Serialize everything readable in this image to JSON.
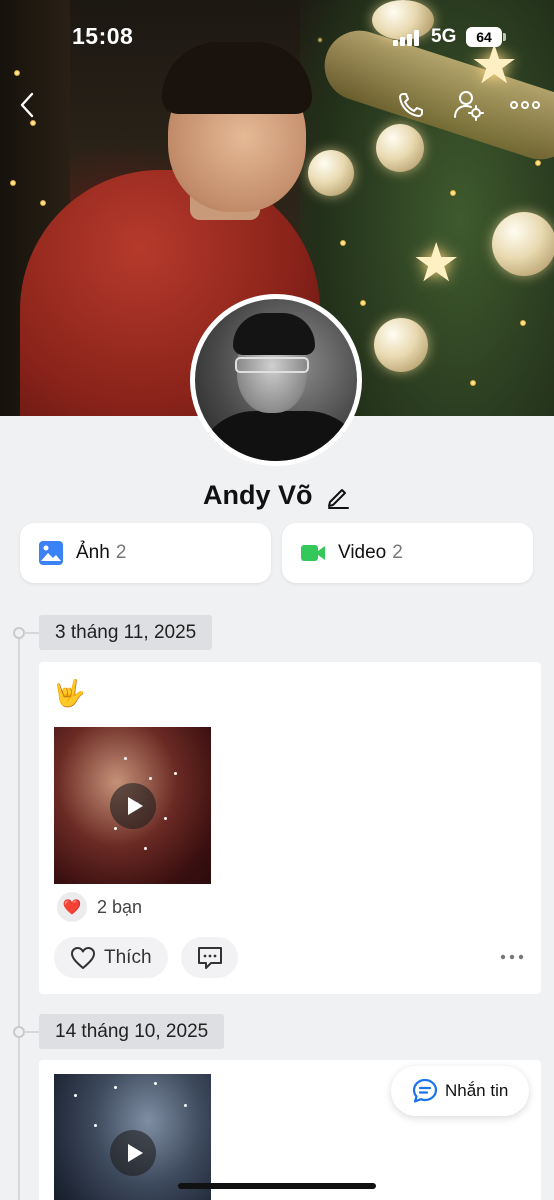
{
  "status_bar": {
    "time": "15:08",
    "network": "5G",
    "battery": "64"
  },
  "header": {
    "icons": [
      "back-icon",
      "call-icon",
      "profile-settings-icon",
      "more-icon"
    ]
  },
  "profile": {
    "name": "Andy Võ"
  },
  "media": {
    "photos": {
      "label": "Ảnh",
      "count": "2",
      "icon": "image-icon",
      "color": "#3b82f6"
    },
    "videos": {
      "label": "Video",
      "count": "2",
      "icon": "video-icon",
      "color": "#34c759"
    }
  },
  "timeline": [
    {
      "date": "3 tháng 11, 2025",
      "emoji": "🤟",
      "media_type": "video",
      "reaction_emoji": "❤️",
      "reaction_text": "2 bạn",
      "like_label": "Thích"
    },
    {
      "date": "14 tháng 10, 2025",
      "media_type": "video"
    }
  ],
  "fab": {
    "label": "Nhắn tin",
    "icon": "chat-icon"
  },
  "colors": {
    "accent": "#1a73e8",
    "background": "#f0f1f3"
  }
}
